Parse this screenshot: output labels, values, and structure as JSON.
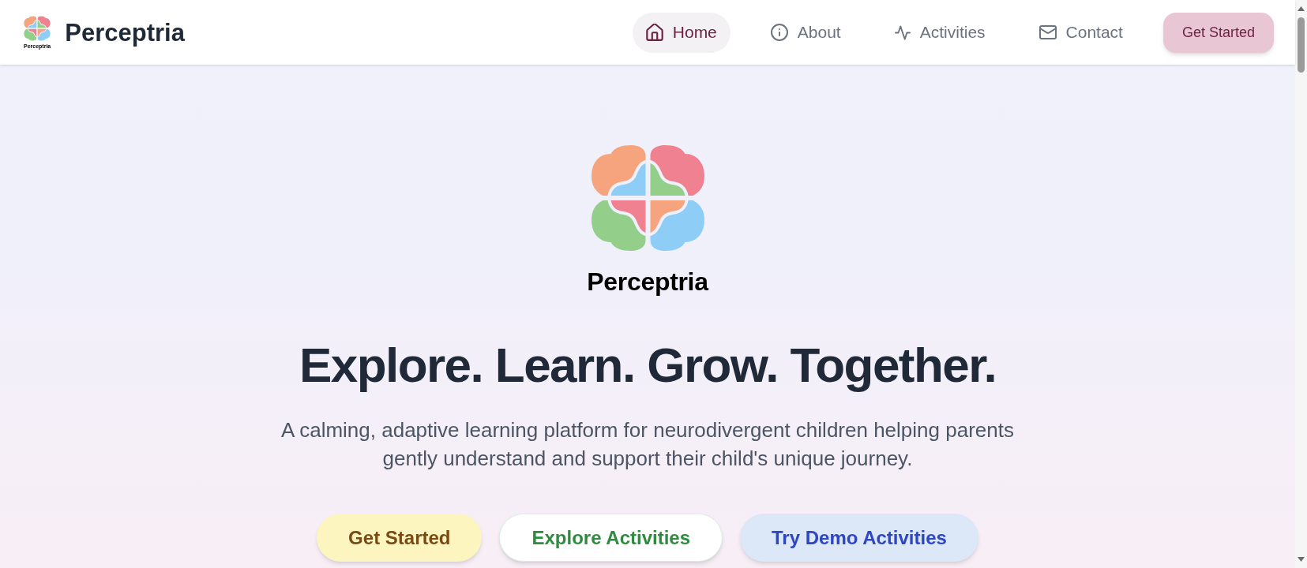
{
  "header": {
    "logo": {
      "wordmark": "Perceptria"
    },
    "title": "Perceptria",
    "nav": [
      {
        "label": "Home",
        "kind": "home",
        "selected": true
      },
      {
        "label": "About",
        "kind": "info",
        "selected": false
      },
      {
        "label": "Activities",
        "kind": "activity",
        "selected": false
      },
      {
        "label": "Contact",
        "kind": "mail",
        "selected": false
      }
    ],
    "cta": {
      "label": "Get Started"
    }
  },
  "hero": {
    "logo": {
      "wordmark": "Perceptria"
    },
    "headline": "Explore. Learn. Grow. Together.",
    "subtitle": "A calming, adaptive learning platform for neurodivergent children helping parents gently understand and support their child's unique journey.",
    "buttons": [
      {
        "label": "Get Started",
        "kind": "primary"
      },
      {
        "label": "Explore Activities",
        "kind": "outline"
      },
      {
        "label": "Try Demo Activities",
        "kind": "demo"
      }
    ]
  }
}
